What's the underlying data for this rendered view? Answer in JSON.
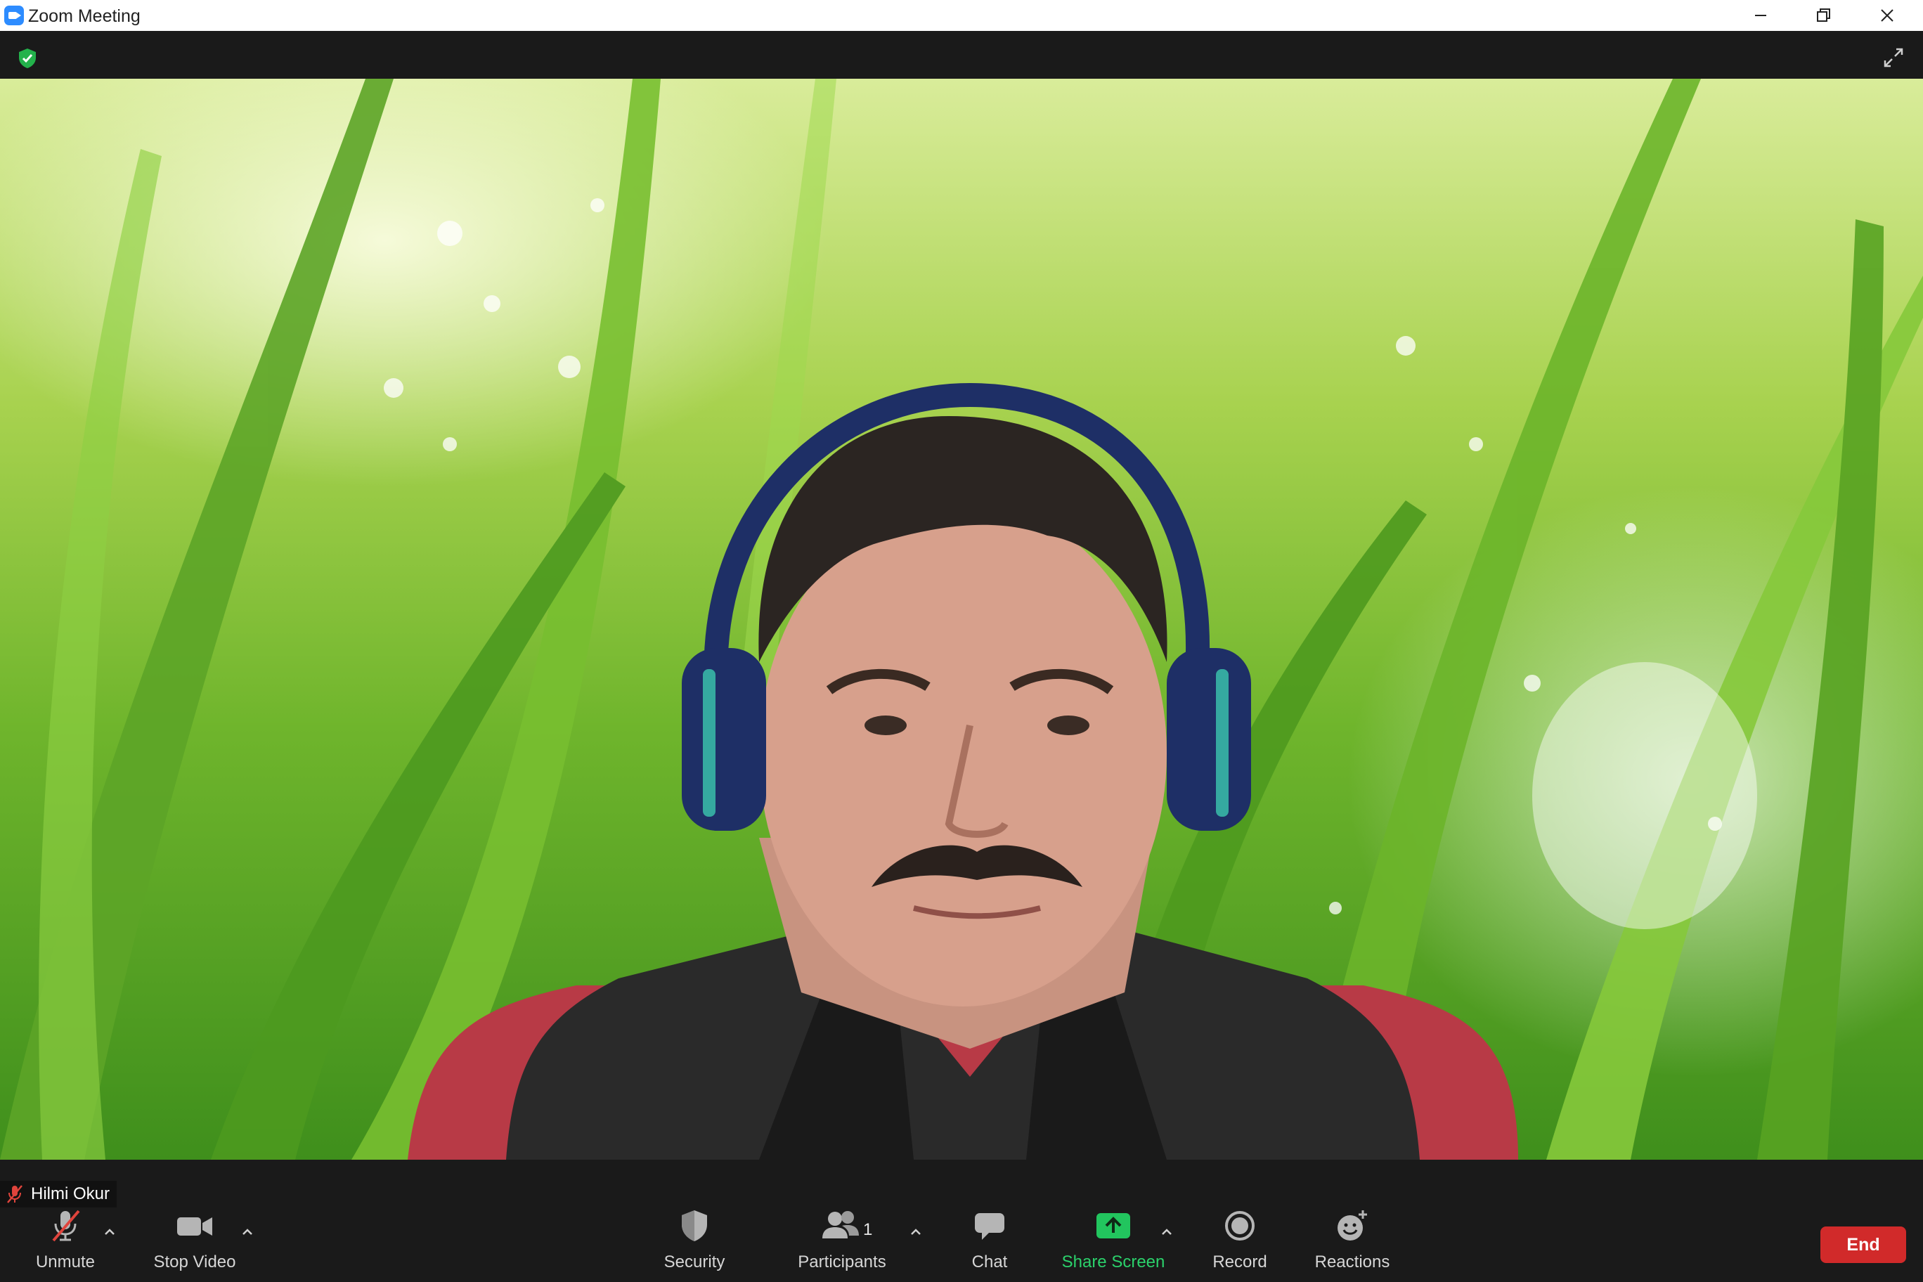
{
  "window": {
    "title": "Zoom Meeting"
  },
  "participant": {
    "name": "Hilmi Okur"
  },
  "toolbar": {
    "unmute_label": "Unmute",
    "stop_video_label": "Stop Video",
    "security_label": "Security",
    "participants_label": "Participants",
    "participants_count": "1",
    "chat_label": "Chat",
    "share_screen_label": "Share Screen",
    "record_label": "Record",
    "reactions_label": "Reactions",
    "end_label": "End"
  },
  "icons": {
    "app": "zoom-app-icon",
    "encryption": "shield-check-icon",
    "fullscreen": "expand-icon",
    "mic": "microphone-muted-icon",
    "video": "camera-icon",
    "security": "shield-icon",
    "participants": "people-icon",
    "chat": "chat-bubble-icon",
    "share": "share-screen-arrow-icon",
    "record": "record-circle-icon",
    "reactions": "smiley-plus-icon"
  },
  "colors": {
    "accent_green": "#2bd16b",
    "end_red": "#d12a2a",
    "zoom_blue": "#2d8cff",
    "muted_red": "#e0443c"
  }
}
